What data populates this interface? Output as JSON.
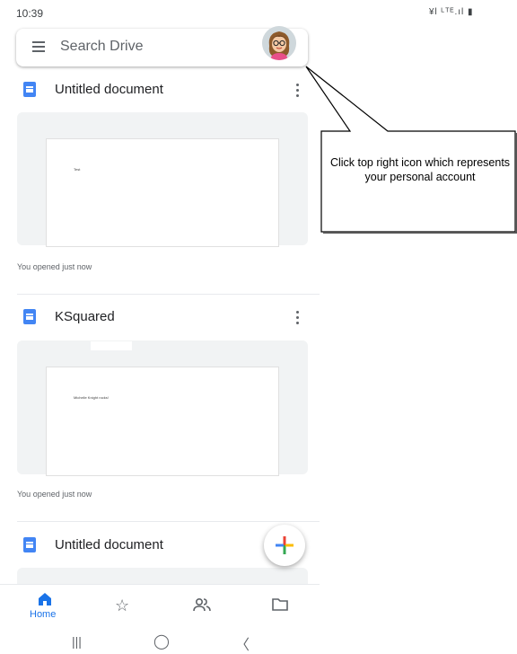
{
  "status_bar": {
    "time": "10:39",
    "icons": "¥l ᴸᵀᴱ.ıl ▮"
  },
  "search": {
    "placeholder": "Search Drive",
    "menu_icon": "hamburger-menu-icon",
    "avatar_icon": "account-avatar-icon"
  },
  "files": [
    {
      "title": "Untitled document",
      "page_text": "Test",
      "opened": "You opened just now"
    },
    {
      "title": "KSquared",
      "page_text": "Michelle Knight rocks!",
      "opened": "You opened just now"
    },
    {
      "title": "Untitled document"
    }
  ],
  "fab": {
    "icon": "plus-icon"
  },
  "bottom_nav": {
    "home_label": "Home",
    "items": [
      "home-icon",
      "star-icon",
      "shared-people-icon",
      "folder-icon"
    ]
  },
  "system_nav": {
    "recents": "|||",
    "home": "◯",
    "back": "〈"
  },
  "callout": {
    "text": "Click top right icon which represents your personal account"
  },
  "colors": {
    "accent": "#1a73e8",
    "doc_blue": "#4285f4",
    "thumb_bg": "#f1f3f4"
  }
}
